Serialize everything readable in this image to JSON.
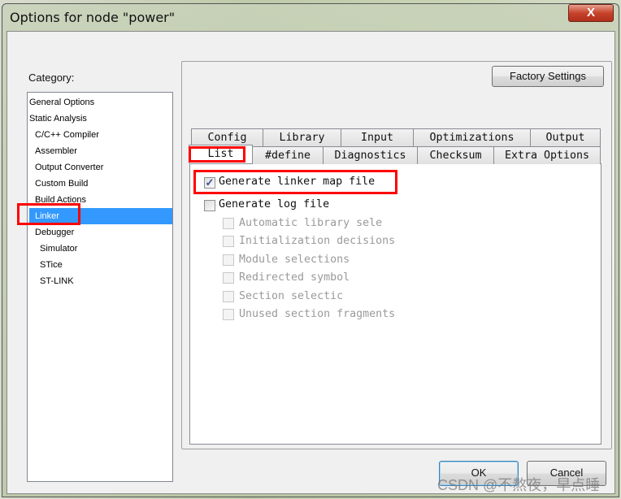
{
  "window": {
    "title": "Options for node \"power\"",
    "close_label": "X"
  },
  "category": {
    "label": "Category:",
    "items": [
      {
        "label": "General Options",
        "level": 0,
        "selected": false
      },
      {
        "label": "Static Analysis",
        "level": 0,
        "selected": false
      },
      {
        "label": "C/C++ Compiler",
        "level": 1,
        "selected": false
      },
      {
        "label": "Assembler",
        "level": 1,
        "selected": false
      },
      {
        "label": "Output Converter",
        "level": 1,
        "selected": false
      },
      {
        "label": "Custom Build",
        "level": 1,
        "selected": false
      },
      {
        "label": "Build Actions",
        "level": 1,
        "selected": false
      },
      {
        "label": "Linker",
        "level": 1,
        "selected": true
      },
      {
        "label": "Debugger",
        "level": 1,
        "selected": false
      },
      {
        "label": "Simulator",
        "level": 2,
        "selected": false
      },
      {
        "label": "STice",
        "level": 2,
        "selected": false
      },
      {
        "label": "ST-LINK",
        "level": 2,
        "selected": false
      }
    ]
  },
  "factory_settings_label": "Factory Settings",
  "tabs": {
    "row1": [
      "Config",
      "Library",
      "Input",
      "Optimizations",
      "Output"
    ],
    "row2": [
      "List",
      "#define",
      "Diagnostics",
      "Checksum",
      "Extra Options"
    ],
    "selected": "List"
  },
  "options": [
    {
      "label": "Generate linker map file",
      "checked": true,
      "enabled": true
    },
    {
      "label": "Generate log file",
      "checked": false,
      "enabled": true
    },
    {
      "label": "Automatic library sele",
      "checked": false,
      "enabled": false
    },
    {
      "label": "Initialization decisions",
      "checked": false,
      "enabled": false
    },
    {
      "label": "Module selections",
      "checked": false,
      "enabled": false
    },
    {
      "label": "Redirected symbol",
      "checked": false,
      "enabled": false
    },
    {
      "label": "Section selectic",
      "checked": false,
      "enabled": false
    },
    {
      "label": "Unused section fragments",
      "checked": false,
      "enabled": false
    }
  ],
  "buttons": {
    "ok": "OK",
    "cancel": "Cancel"
  },
  "watermark": "CSDN @不熬夜，早点睡",
  "colors": {
    "selection": "#3399ff",
    "highlight_box": "#ff0000"
  }
}
